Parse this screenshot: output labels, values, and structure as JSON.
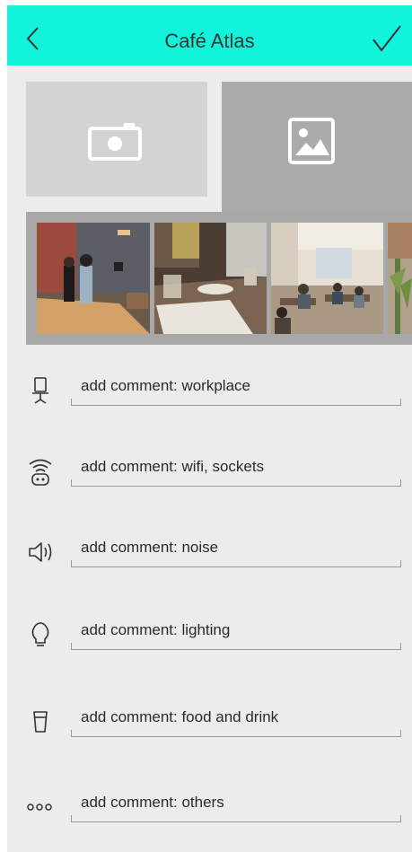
{
  "header": {
    "title": "Café Atlas",
    "back_icon": "chevron-left-icon",
    "confirm_icon": "checkmark-icon",
    "bg_color": "#12f3dc"
  },
  "media_tabs": [
    {
      "name": "camera",
      "icon": "camera-icon",
      "selected": false
    },
    {
      "name": "gallery",
      "icon": "image-icon",
      "selected": true
    }
  ],
  "photos": [
    {
      "desc": "two people standing in a café with wooden table"
    },
    {
      "desc": "table with papers and a glass"
    },
    {
      "desc": "people working at tables in bright café"
    },
    {
      "desc": "partial view of plants"
    }
  ],
  "comments": [
    {
      "icon": "desk-chair-icon",
      "placeholder": "add comment: workplace"
    },
    {
      "icon": "wifi-socket-icon",
      "placeholder": "add comment: wifi, sockets"
    },
    {
      "icon": "speaker-icon",
      "placeholder": "add comment: noise"
    },
    {
      "icon": "lightbulb-icon",
      "placeholder": "add comment: lighting"
    },
    {
      "icon": "cup-icon",
      "placeholder": "add comment: food and drink"
    },
    {
      "icon": "more-dots-icon",
      "placeholder": "add comment: others"
    }
  ]
}
